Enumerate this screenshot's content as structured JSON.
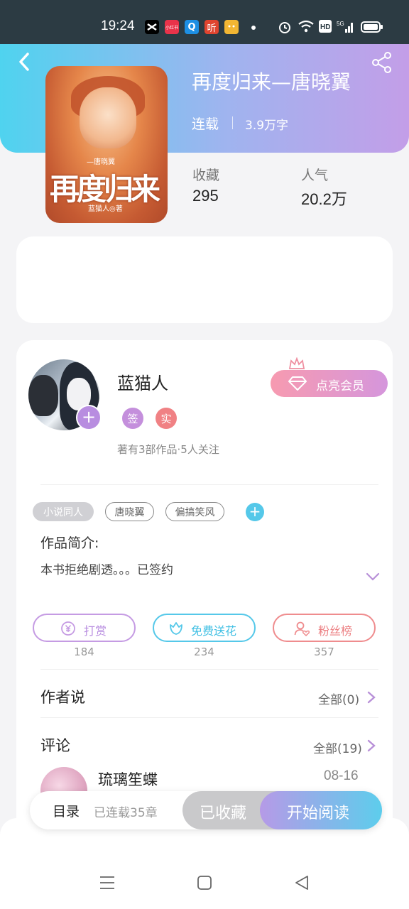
{
  "status_bar": {
    "time": "19:24",
    "app_icons": [
      {
        "name": "capcut-icon",
        "label": "",
        "color": "#000000"
      },
      {
        "name": "xiaohongshu-icon",
        "label": "小红书",
        "color": "#e8334a"
      },
      {
        "name": "qq-browser-icon",
        "label": "Q",
        "color": "#1d8fe3"
      },
      {
        "name": "listen-app-icon",
        "label": "听",
        "color": "#e0442f"
      },
      {
        "name": "emoji-app-icon",
        "label": "",
        "color": "#f2b633"
      }
    ],
    "network": "5G"
  },
  "header": {
    "gradient": [
      "#4fd3ef",
      "#c39ee8"
    ]
  },
  "book": {
    "title": "再度归来—唐晓翼",
    "status": "连载",
    "word_count": "3.9万字",
    "cover": {
      "title": "再度归来",
      "subtitle": "—唐晓翼",
      "author": "蓝猫人◎著"
    },
    "stats": [
      {
        "label": "收藏",
        "value": "295"
      },
      {
        "label": "人气",
        "value": "20.2万"
      }
    ]
  },
  "author": {
    "name": "蓝猫人",
    "badges": [
      {
        "text": "签",
        "color": "#c48fdc"
      },
      {
        "text": "实",
        "color": "#f08184"
      }
    ],
    "works_info": "著有3部作品·5人关注",
    "vip_label": "点亮会员"
  },
  "tags": [
    {
      "text": "小说同人",
      "style": "filled"
    },
    {
      "text": "唐晓翼",
      "style": "outline"
    },
    {
      "text": "偏搞笑风",
      "style": "outline"
    }
  ],
  "intro": {
    "label": "作品简介:",
    "text": "本书拒绝剧透。。。已签约"
  },
  "actions": [
    {
      "label": "打赏",
      "count": "184",
      "color": "#c59be3",
      "icon": "yuan-coin-icon"
    },
    {
      "label": "免费送花",
      "count": "234",
      "color": "#55c8e9",
      "icon": "flower-icon"
    },
    {
      "label": "粉丝榜",
      "count": "357",
      "color": "#ef8c8e",
      "icon": "fan-user-icon"
    }
  ],
  "author_says": {
    "title": "作者说",
    "link": "全部(0)"
  },
  "comments": {
    "title": "评论",
    "link": "全部(19)",
    "items": [
      {
        "user": "琉璃笙蝶",
        "date": "08-16"
      }
    ]
  },
  "bottom_bar": {
    "toc_label": "目录",
    "toc_count": "已连载35章",
    "favorite_label": "已收藏",
    "read_label": "开始阅读"
  }
}
